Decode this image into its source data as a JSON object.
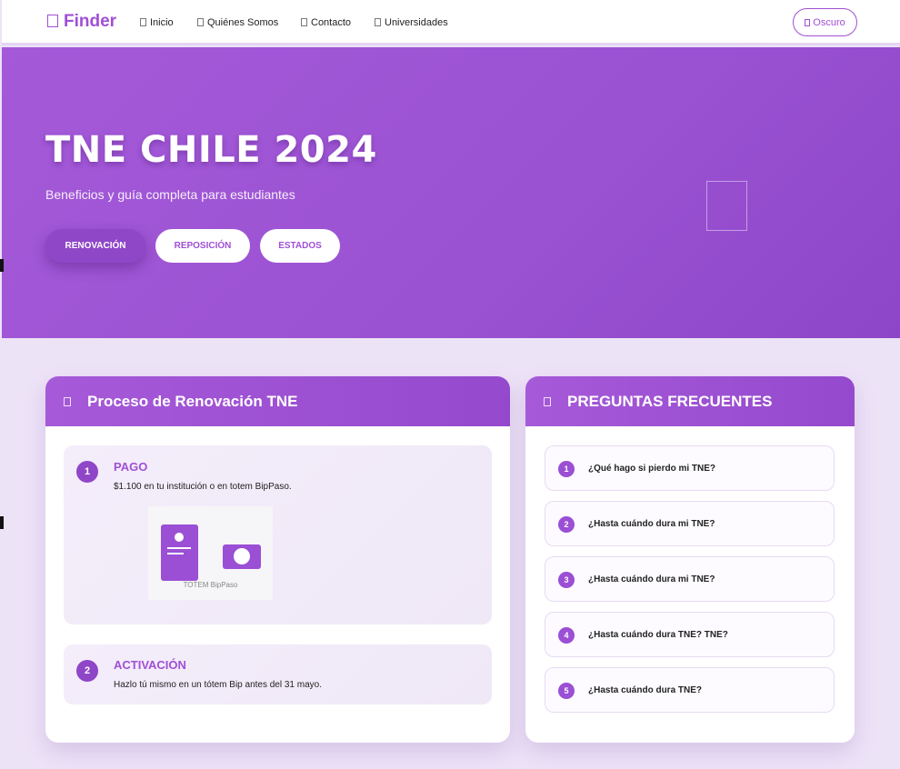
{
  "nav": {
    "brand": "Finder",
    "items": [
      {
        "label": "Inicio"
      },
      {
        "label": "Quiénes Somos"
      },
      {
        "label": "Contacto"
      },
      {
        "label": "Universidades"
      }
    ],
    "theme_toggle": "Oscuro"
  },
  "hero": {
    "title": "TNE CHILE 2024",
    "subtitle": "Beneficios y guía completa para estudiantes",
    "buttons": [
      {
        "label": "RENOVACIÓN",
        "active": true
      },
      {
        "label": "REPOSICIÓN",
        "active": false
      },
      {
        "label": "ESTADOS",
        "active": false
      }
    ]
  },
  "process": {
    "title": "Proceso de Renovación TNE",
    "steps": [
      {
        "num": "1",
        "title": "PAGO",
        "desc": "$1.100 en tu institución o en totem BipPaso.",
        "illustration_label": "TOTEM BipPaso"
      },
      {
        "num": "2",
        "title": "ACTIVACIÓN",
        "desc": "Hazlo tú mismo en un tótem Bip antes del 31 mayo."
      }
    ]
  },
  "faq": {
    "title": "PREGUNTAS FRECUENTES",
    "items": [
      {
        "num": "1",
        "question": "¿Qué hago si pierdo mi TNE?"
      },
      {
        "num": "2",
        "question": "¿Hasta cuándo dura mi TNE?"
      },
      {
        "num": "3",
        "question": "¿Hasta cuándo dura mi TNE?"
      },
      {
        "num": "4",
        "question": "¿Hasta cuándo dura TNE? TNE?"
      },
      {
        "num": "5",
        "question": "¿Hasta cuándo dura TNE?"
      }
    ]
  },
  "colors": {
    "accent": "#a04fd6",
    "hero": "#9a52d2",
    "page_bg": "#ede3f7"
  }
}
